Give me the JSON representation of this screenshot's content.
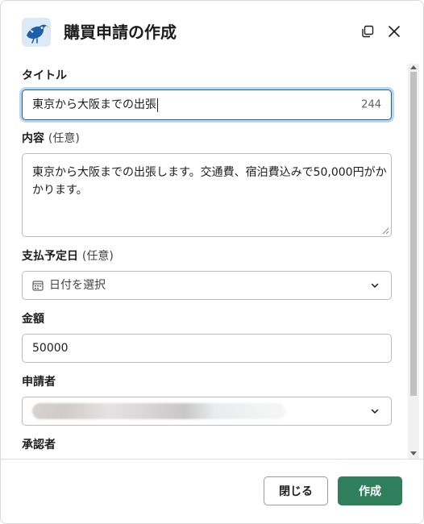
{
  "modal": {
    "title": "購買申請の作成",
    "app_icon": "bird-logo-icon",
    "popout_icon": "popout-icon",
    "close_icon": "close-icon"
  },
  "form": {
    "title_field": {
      "label": "タイトル",
      "value": "東京から大阪までの出張",
      "remaining_chars": "244"
    },
    "content_field": {
      "label": "内容",
      "optional": "(任意)",
      "value": "東京から大阪までの出張します。交通費、宿泊費込みで50,000円がかかります。"
    },
    "payment_date_field": {
      "label": "支払予定日",
      "optional": "(任意)",
      "placeholder": "日付を選択",
      "icon": "calendar-icon"
    },
    "amount_field": {
      "label": "金額",
      "value": "50000"
    },
    "applicant_field": {
      "label": "申請者",
      "value_redacted": true
    },
    "approver_field": {
      "label": "承認者"
    }
  },
  "footer": {
    "close_label": "閉じる",
    "create_label": "作成"
  },
  "colors": {
    "primary": "#2f7e5c",
    "focus_border": "#1264a3",
    "focus_ring": "#bcd6ee"
  }
}
